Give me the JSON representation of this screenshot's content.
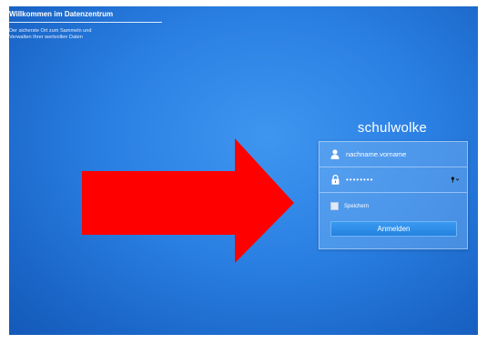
{
  "welcome": {
    "title": "Willkommen im Datenzentrum",
    "subtitle": "Der sicherste Ort zum Sammeln und\nVerwalten Ihrer wertvollen Daten"
  },
  "brand": {
    "name": "schulwolke"
  },
  "login": {
    "username": {
      "value": "nachname.vorname",
      "icon": "user-icon"
    },
    "password": {
      "value": "••••••••",
      "icon": "lock-icon",
      "toggle_icon": "key-dropdown-icon"
    },
    "remember_label": "Speichern",
    "remember_checked": false,
    "submit_label": "Anmelden"
  },
  "annotation": {
    "arrow_color": "#ff0000",
    "arrow_icon": "right-arrow"
  },
  "colors": {
    "background": "#2a7fe2",
    "button": "#2886e0"
  }
}
